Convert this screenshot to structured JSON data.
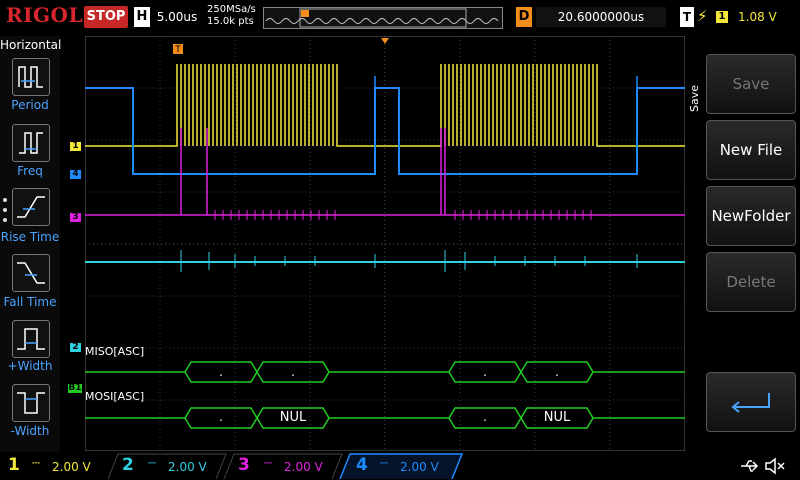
{
  "logo": "RIGOL",
  "run_state": "STOP",
  "horizontal": {
    "badge": "H",
    "timebase": "5.00us",
    "sample_rate": "250MSa/s",
    "memory": "15.0k pts"
  },
  "delay": {
    "badge": "D",
    "value": "20.6000000us"
  },
  "trigger": {
    "badge": "T",
    "slope_icon": "rising-edge-icon",
    "source": "1",
    "level": "1.08 V"
  },
  "left_menu": {
    "title": "Horizontal",
    "items": [
      {
        "label": "Period",
        "icon": "period-measure-icon"
      },
      {
        "label": "Freq",
        "icon": "freq-measure-icon"
      },
      {
        "label": "Rise Time",
        "icon": "rise-time-icon"
      },
      {
        "label": "Fall Time",
        "icon": "fall-time-icon"
      },
      {
        "label": "+Width",
        "icon": "pos-width-icon"
      },
      {
        "label": "-Width",
        "icon": "neg-width-icon"
      }
    ]
  },
  "right_menu": {
    "side_label": "Save",
    "items": [
      {
        "label": "Save",
        "enabled": false
      },
      {
        "label": "New File",
        "enabled": true
      },
      {
        "label": "NewFolder",
        "enabled": true
      },
      {
        "label": "Delete",
        "enabled": false
      }
    ],
    "back_icon": "return-arrow-icon"
  },
  "channel_markers": [
    {
      "label": "1",
      "color": "#f2e73a"
    },
    {
      "label": "4",
      "color": "#1e8cff"
    },
    {
      "label": "3",
      "color": "#e020e0"
    },
    {
      "label": "2",
      "color": "#30d0e0"
    },
    {
      "label": "B1",
      "color": "#22cc22"
    }
  ],
  "decode": {
    "miso_label": "MISO[ASC]",
    "mosi_label": "MOSI[ASC]",
    "miso_frames": [
      ".",
      ".",
      ".",
      "."
    ],
    "mosi_frames": [
      ".",
      "NUL",
      ".",
      "NUL"
    ]
  },
  "channels": [
    {
      "num": "1",
      "value": "2.00 V",
      "color": "#f2e73a"
    },
    {
      "num": "2",
      "value": "2.00 V",
      "color": "#30d0e0"
    },
    {
      "num": "3",
      "value": "2.00 V",
      "color": "#e020e0"
    },
    {
      "num": "4",
      "value": "2.00 V",
      "color": "#1e8cff"
    }
  ],
  "status_icons": [
    "usb-icon",
    "speaker-mute-icon"
  ]
}
